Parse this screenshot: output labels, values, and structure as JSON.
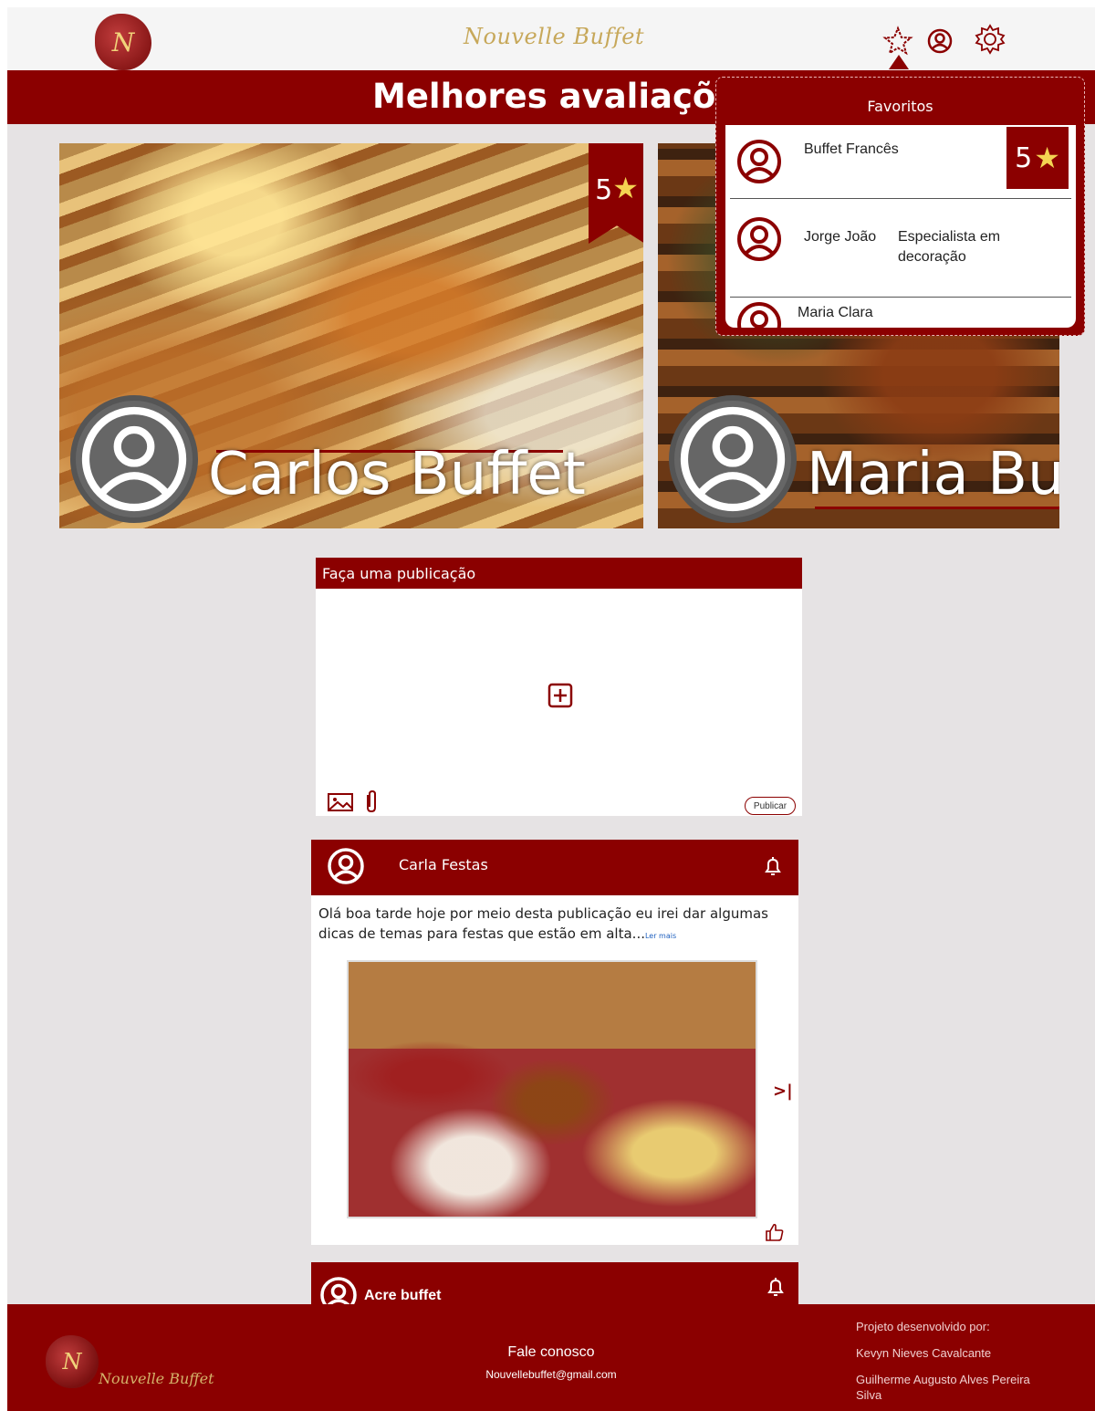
{
  "header": {
    "logo_mark": "N",
    "brand": "Nouvelle Buffet"
  },
  "title": "Melhores avaliações",
  "top_rated": [
    {
      "name": "Carlos Buffet",
      "rating": "5"
    },
    {
      "name": "Maria Buffet",
      "rating": ""
    }
  ],
  "favorites": {
    "title": "Favoritos",
    "items": [
      {
        "name": "Buffet Francês",
        "description": "",
        "rating": "5"
      },
      {
        "name": "Jorge João",
        "description": "Especialista em decoração",
        "rating": ""
      },
      {
        "name": "Maria Clara",
        "description": "",
        "rating": ""
      }
    ]
  },
  "publish": {
    "title": "Faça uma publicação",
    "button": "Publicar"
  },
  "posts": [
    {
      "author": "Carla Festas",
      "text": "Olá boa tarde hoje por meio desta publicação eu irei dar algumas dicas de temas para festas que estão em alta...",
      "read_more": "Ler mais",
      "next": ">|"
    },
    {
      "author": "Acre buffet"
    }
  ],
  "footer": {
    "logo_mark": "N",
    "brand": "Nouvelle Buffet",
    "contact_title": "Fale conosco",
    "contact_email": "Nouvellebuffet@gmail.com",
    "credits_title": "Projeto desenvolvido por:",
    "credits": [
      "Kevyn Nieves Cavalcante",
      "Guilherme Augusto Alves Pereira Silva"
    ]
  },
  "colors": {
    "primary": "#8b0000",
    "background": "#e6e3e4",
    "gold": "#c7a85a",
    "star": "#f4d452"
  },
  "icons": [
    "favorites-star-icon",
    "profile-icon",
    "settings-gear-icon",
    "user-avatar-icon",
    "plus-square-icon",
    "image-icon",
    "attachment-clip-icon",
    "bell-icon",
    "like-thumb-icon"
  ]
}
